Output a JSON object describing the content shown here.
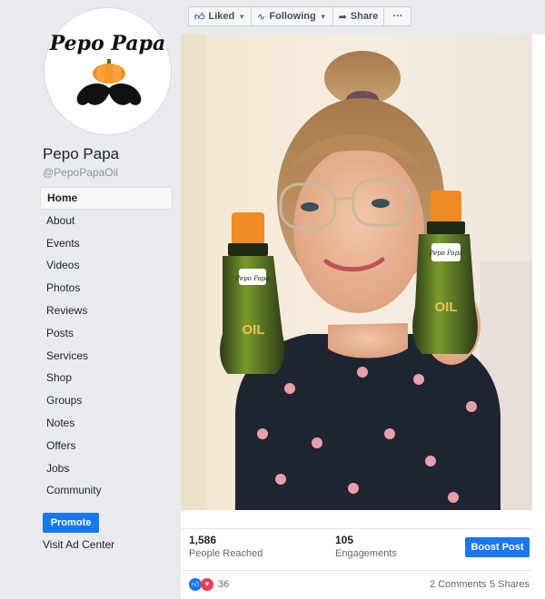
{
  "page": {
    "name": "Pepo Papa",
    "handle": "@PepoPapaOil",
    "logo_text": "Pepo Papa"
  },
  "actions": {
    "liked": "Liked",
    "following": "Following",
    "share": "Share",
    "more": "···"
  },
  "nav": [
    "Home",
    "About",
    "Events",
    "Videos",
    "Photos",
    "Reviews",
    "Posts",
    "Services",
    "Shop",
    "Groups",
    "Notes",
    "Offers",
    "Jobs",
    "Community"
  ],
  "promote": "Promote",
  "ad_center": "Visit Ad Center",
  "post": {
    "people_reached": "1,586",
    "people_reached_label": "People Reached",
    "engagements": "105",
    "engagements_label": "Engagements",
    "boost": "Boost Post",
    "reaction_count": "36",
    "comments": "2 Comments",
    "shares": "5 Shares",
    "bottle_label": "Pepo Papa",
    "bottle_text": "OIL"
  },
  "colors": {
    "accent": "#1877f2",
    "pumpkin": "#f28c1b",
    "bottle_green": "#7a9a2c"
  }
}
